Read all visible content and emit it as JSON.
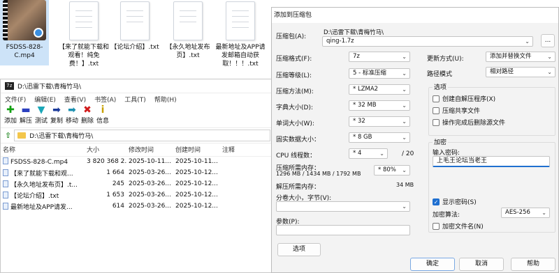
{
  "desktop": {
    "items": [
      {
        "name": "FSDSS-828-C.mp4",
        "type": "video"
      },
      {
        "name": "【来了就能下载和观看！纯免费！】.txt",
        "type": "text"
      },
      {
        "name": "【论坛介绍】.txt",
        "type": "text"
      },
      {
        "name": "【永久地址发布页】.txt",
        "type": "text"
      },
      {
        "name": "最新地址及APP请发邮箱自动获取！！！.txt",
        "type": "text"
      }
    ]
  },
  "fm": {
    "title": "D:\\迅雷下载\\青梅竹马\\",
    "menu": [
      "文件(F)",
      "编辑(E)",
      "查看(V)",
      "书签(A)",
      "工具(T)",
      "帮助(H)"
    ],
    "toolbar": [
      {
        "label": "添加",
        "icon": "plus-icon",
        "color": "#12a012",
        "glyph": "✚"
      },
      {
        "label": "解压",
        "icon": "minus-icon",
        "color": "#2a3fbf",
        "glyph": "▬"
      },
      {
        "label": "测试",
        "icon": "check-arrow-icon",
        "color": "#1ba7b8",
        "glyph": "▼"
      },
      {
        "label": "复制",
        "icon": "copy-arrow-icon",
        "color": "#1a3a9a",
        "glyph": "➡"
      },
      {
        "label": "移动",
        "icon": "move-arrow-icon",
        "color": "#1a8fb0",
        "glyph": "➡"
      },
      {
        "label": "删除",
        "icon": "delete-icon",
        "color": "#d01a1a",
        "glyph": "✖"
      },
      {
        "label": "信息",
        "icon": "info-icon",
        "color": "#c8a000",
        "glyph": "i"
      }
    ],
    "path": "D:\\迅雷下载\\青梅竹马\\",
    "columns": [
      "名称",
      "大小",
      "修改时间",
      "创建时间",
      "注释"
    ],
    "rows": [
      {
        "name": "FSDSS-828-C.mp4",
        "size": "3 820 368 2...",
        "mtime": "2025-10-11...",
        "ctime": "2025-10-11..."
      },
      {
        "name": "【来了就能下载和观...",
        "size": "1 664",
        "mtime": "2025-03-26...",
        "ctime": "2025-10-12..."
      },
      {
        "name": "【永久地址发布页】.t...",
        "size": "245",
        "mtime": "2025-03-26...",
        "ctime": "2025-10-12..."
      },
      {
        "name": "【论坛介绍】.txt",
        "size": "1 653",
        "mtime": "2025-03-26...",
        "ctime": "2025-10-12..."
      },
      {
        "name": "最新地址及APP请发...",
        "size": "614",
        "mtime": "2025-03-26...",
        "ctime": "2025-10-12..."
      }
    ]
  },
  "dlg": {
    "title": "添加到压缩包",
    "archive_label": "压缩包(A):",
    "archive_path": "D:\\迅雷下载\\青梅竹马\\",
    "archive_name": "qing-1.7z",
    "browse": "...",
    "format_label": "压缩格式(F):",
    "format": "7z",
    "level_label": "压缩等级(L):",
    "level": "5 - 标准压缩",
    "method_label": "压缩方法(M):",
    "method": "* LZMA2",
    "dict_label": "字典大小(D):",
    "dict": "* 32 MB",
    "word_label": "单词大小(W):",
    "word": "* 32",
    "solid_label": "固实数据大小：",
    "solid": "* 8 GB",
    "cpu_label": "CPU 线程数：",
    "cpu": "* 4",
    "cpu_total": "/ 20",
    "mem_label": "压缩所需内存：",
    "mem_detail": "1296 MB / 1434 MB / 1792 MB",
    "mem_pct": "* 80%",
    "dmem_label": "解压所需内存：",
    "dmem": "34 MB",
    "split_label": "分卷大小，字节(V):",
    "params_label": "参数(P):",
    "options_btn": "选项",
    "update_label": "更新方式(U):",
    "update": "添加并替换文件",
    "pathmode_label": "路径模式",
    "pathmode": "相对路径",
    "opts_title": "选项",
    "opt_sfx": "创建自解压程序(X)",
    "opt_shared": "压缩共享文件",
    "opt_delete": "操作完成后删除源文件",
    "enc_title": "加密",
    "pwd_label": "输入密码:",
    "pwd": "上毛王论坛当老王",
    "show_pwd": "显示密码(S)",
    "enc_method_label": "加密算法:",
    "enc_method": "AES-256",
    "enc_names": "加密文件名(N)",
    "ok": "确定",
    "cancel": "取消",
    "help": "帮助"
  }
}
